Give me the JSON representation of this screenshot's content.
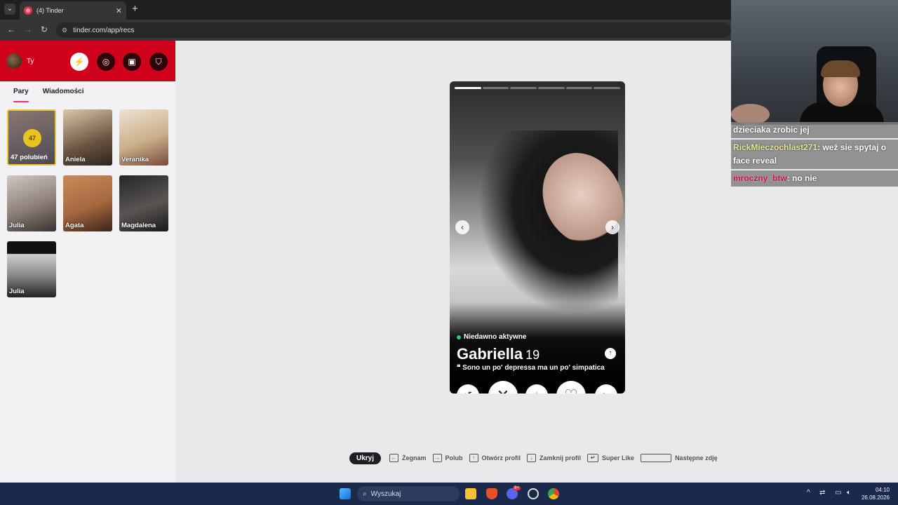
{
  "browser": {
    "tab_title": "(4) Tinder",
    "url": "tinder.com/app/recs"
  },
  "sidebar": {
    "user_name": "Ty",
    "tabs": [
      {
        "label": "Pary"
      },
      {
        "label": "Wiadomości"
      }
    ],
    "likes": {
      "count": "47",
      "label": "47 polubień"
    },
    "matches": [
      {
        "name": "Aniela"
      },
      {
        "name": "Veranika"
      },
      {
        "name": "Julia"
      },
      {
        "name": "Agata"
      },
      {
        "name": "Magdalena"
      },
      {
        "name": "Julia"
      }
    ]
  },
  "card": {
    "status": "Niedawno aktywne",
    "name": "Gabriella",
    "age": "19",
    "bio": "Sono un po' depressa ma un po' simpatica",
    "photo_count": 6,
    "current_photo": 1
  },
  "shortcuts": {
    "hide": "Ukryj",
    "nope": "Żegnam",
    "like": "Polub",
    "open_profile": "Otwórz profil",
    "close_profile": "Zamknij profil",
    "super_like": "Super Like",
    "next_photo": "Następne zdję"
  },
  "chat": {
    "line1": "dzieciaka zrobic jej",
    "msg2_user": "RickMieczochlast271",
    "msg2_text": ": weź sie spytaj o face reveal",
    "msg3_user": "mroczny_btw",
    "msg3_text": ": no nie"
  },
  "taskbar": {
    "search_placeholder": "Wyszukaj",
    "time": "04:10",
    "date": "26.08.2026",
    "discord_badge": "9+"
  },
  "colors": {
    "tinder_red": "#d0011b",
    "accent_pink": "#fd267a",
    "like_gold": "#e9c41d"
  }
}
